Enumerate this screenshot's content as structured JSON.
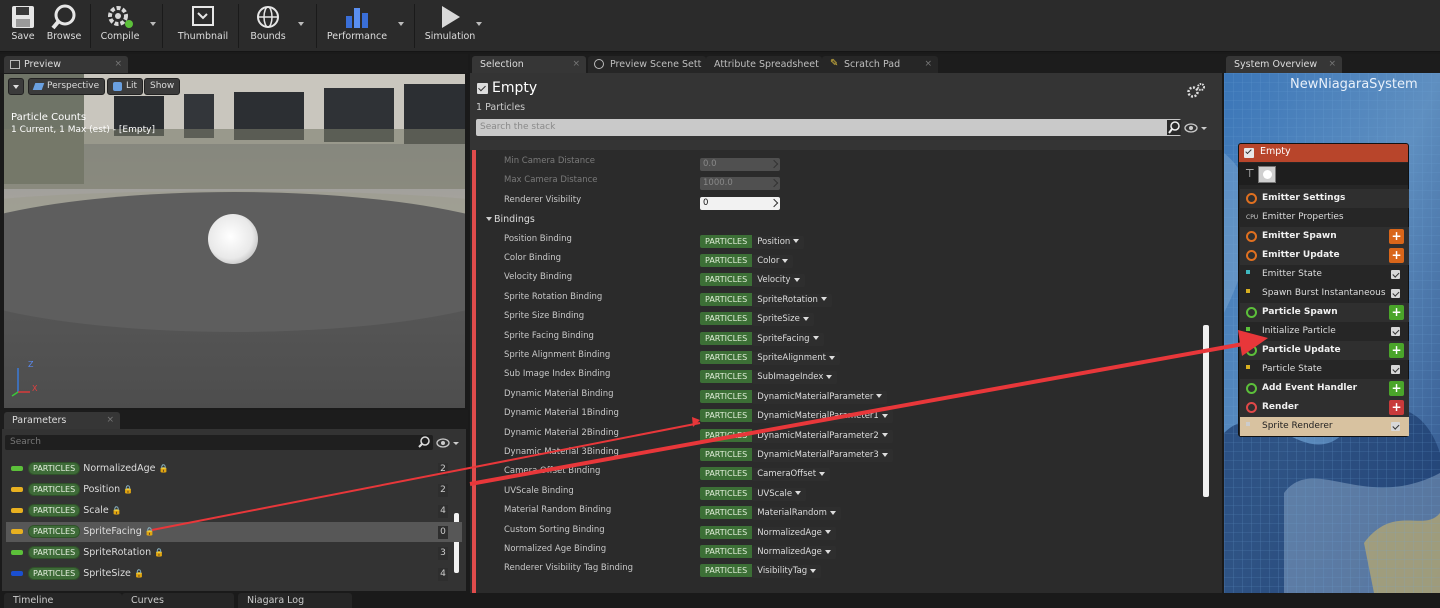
{
  "toolbar": {
    "buttons": [
      {
        "label": "Save",
        "icon": "save-icon"
      },
      {
        "label": "Browse",
        "icon": "browse-icon"
      },
      {
        "label": "Compile",
        "icon": "compile-icon"
      },
      {
        "label": "Thumbnail",
        "icon": "thumbnail-icon"
      },
      {
        "label": "Bounds",
        "icon": "bounds-icon"
      },
      {
        "label": "Performance",
        "icon": "performance-icon"
      },
      {
        "label": "Simulation",
        "icon": "simulation-icon"
      }
    ]
  },
  "preview": {
    "tab": "Preview",
    "buttons": {
      "perspective": "Perspective",
      "lit": "Lit",
      "show": "Show"
    },
    "stats_title": "Particle Counts",
    "stats_line": "1 Current, 1 Max (est) - [Empty]",
    "axis": {
      "z": "Z",
      "x": "X"
    }
  },
  "parameters": {
    "tab": "Parameters",
    "search_placeholder": "Search",
    "rows": [
      {
        "ns": "PARTICLES",
        "name": "NormalizedAge",
        "count": "2",
        "color": "#5cc03a"
      },
      {
        "ns": "PARTICLES",
        "name": "Position",
        "count": "2",
        "color": "#e8b020"
      },
      {
        "ns": "PARTICLES",
        "name": "Scale",
        "count": "4",
        "color": "#e8b020"
      },
      {
        "ns": "PARTICLES",
        "name": "SpriteFacing",
        "count": "0",
        "color": "#e8b020"
      },
      {
        "ns": "PARTICLES",
        "name": "SpriteRotation",
        "count": "3",
        "color": "#5cc03a"
      },
      {
        "ns": "PARTICLES",
        "name": "SpriteSize",
        "count": "4",
        "color": "#1a4fd0"
      }
    ]
  },
  "bottom_tabs": [
    "Timeline",
    "Curves",
    "Niagara Log"
  ],
  "center_tabs": [
    "Selection",
    "Preview Scene Sett",
    "Attribute Spreadsheet",
    "Scratch Pad"
  ],
  "selection": {
    "title": "Empty",
    "subtitle": "1 Particles",
    "search_placeholder": "Search the stack",
    "dim_rows": [
      {
        "label": "Min Camera Distance",
        "value": "0.0"
      },
      {
        "label": "Max Camera Distance",
        "value": "1000.0"
      }
    ],
    "visibility": {
      "label": "Renderer Visibility",
      "value": "0"
    },
    "section": "Bindings",
    "bindings": [
      {
        "label": "Position Binding",
        "value": "Position"
      },
      {
        "label": "Color Binding",
        "value": "Color"
      },
      {
        "label": "Velocity Binding",
        "value": "Velocity"
      },
      {
        "label": "Sprite Rotation Binding",
        "value": "SpriteRotation"
      },
      {
        "label": "Sprite Size Binding",
        "value": "SpriteSize"
      },
      {
        "label": "Sprite Facing Binding",
        "value": "SpriteFacing"
      },
      {
        "label": "Sprite Alignment Binding",
        "value": "SpriteAlignment"
      },
      {
        "label": "Sub Image Index Binding",
        "value": "SubImageIndex"
      },
      {
        "label": "Dynamic Material Binding",
        "value": "DynamicMaterialParameter"
      },
      {
        "label": "Dynamic Material 1Binding",
        "value": "DynamicMaterialParameter1"
      },
      {
        "label": "Dynamic Material 2Binding",
        "value": "DynamicMaterialParameter2"
      },
      {
        "label": "Dynamic Material 3Binding",
        "value": "DynamicMaterialParameter3"
      },
      {
        "label": "Camera Offset Binding",
        "value": "CameraOffset"
      },
      {
        "label": "UVScale Binding",
        "value": "UVScale"
      },
      {
        "label": "Material Random Binding",
        "value": "MaterialRandom"
      },
      {
        "label": "Custom Sorting Binding",
        "value": "NormalizedAge"
      },
      {
        "label": "Normalized Age Binding",
        "value": "NormalizedAge"
      },
      {
        "label": "Renderer Visibility Tag Binding",
        "value": "VisibilityTag"
      }
    ],
    "binding_ns": "PARTICLES"
  },
  "system_overview": {
    "tab": "System Overview",
    "system_name": "NewNiagaraSystem",
    "emitter": {
      "name": "Empty",
      "rows": [
        {
          "label": "Emitter Settings",
          "kind": "header",
          "icon_color": "#e07020"
        },
        {
          "label": "Emitter Properties",
          "kind": "item",
          "icon_text": "CPU"
        },
        {
          "label": "Emitter Spawn",
          "kind": "header-plus",
          "icon_color": "#e07020",
          "btn_color": "#d9661a"
        },
        {
          "label": "Emitter Update",
          "kind": "header-plus",
          "icon_color": "#e07020",
          "btn_color": "#d9661a"
        },
        {
          "label": "Emitter State",
          "kind": "item-check",
          "icon_color": "#3fb8c0"
        },
        {
          "label": "Spawn Burst Instantaneous",
          "kind": "item-check",
          "icon_color": "#d8b020"
        },
        {
          "label": "Particle Spawn",
          "kind": "header-plus",
          "icon_color": "#5cc03a",
          "btn_color": "#4aa52a"
        },
        {
          "label": "Initialize Particle",
          "kind": "item-check",
          "icon_color": "#5cc03a"
        },
        {
          "label": "Particle Update",
          "kind": "header-plus",
          "icon_color": "#5cc03a",
          "btn_color": "#4aa52a"
        },
        {
          "label": "Particle State",
          "kind": "item-check",
          "icon_color": "#d8b020"
        },
        {
          "label": "Add Event Handler",
          "kind": "header-plus",
          "icon_color": "#5cc03a",
          "btn_color": "#4aa52a"
        },
        {
          "label": "Render",
          "kind": "header-plus",
          "icon_color": "#e04848",
          "btn_color": "#c83a3a"
        },
        {
          "label": "Sprite Renderer",
          "kind": "selected-check",
          "icon_color": "#cccccc"
        }
      ]
    }
  },
  "colors": {
    "accent_red": "#e8373a",
    "particles_pill": "#3e6b38"
  }
}
